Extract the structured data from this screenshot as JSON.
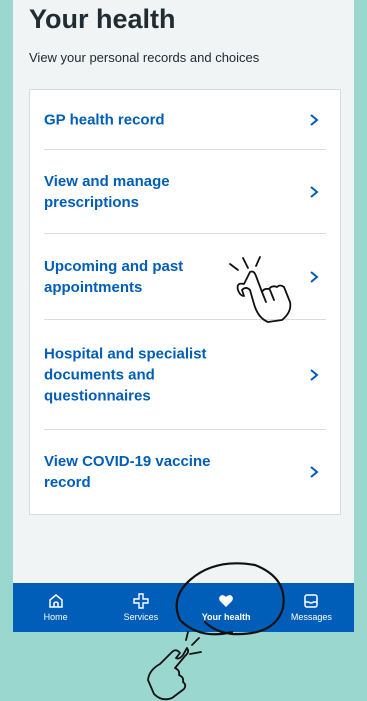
{
  "header": {
    "title": "Your health",
    "subtitle": "View your personal records and choices"
  },
  "menu": {
    "items": [
      {
        "lines": [
          "GP health record"
        ]
      },
      {
        "lines": [
          "View and manage",
          "prescriptions"
        ]
      },
      {
        "lines": [
          "Upcoming and past",
          "appointments"
        ]
      },
      {
        "lines": [
          "Hospital and specialist",
          "documents and",
          "questionnaires"
        ]
      },
      {
        "lines": [
          "View COVID-19 vaccine",
          "record"
        ]
      }
    ]
  },
  "nav": {
    "items": [
      {
        "label": "Home",
        "icon": "home-icon"
      },
      {
        "label": "Services",
        "icon": "services-cross-icon"
      },
      {
        "label": "Your health",
        "icon": "heart-icon",
        "active": true
      },
      {
        "label": "Messages",
        "icon": "inbox-icon"
      }
    ]
  },
  "colors": {
    "background": "#9ad8cf",
    "page": "#f0f4f5",
    "link": "#005eb8",
    "nav": "#005eb8",
    "text": "#212b32"
  }
}
